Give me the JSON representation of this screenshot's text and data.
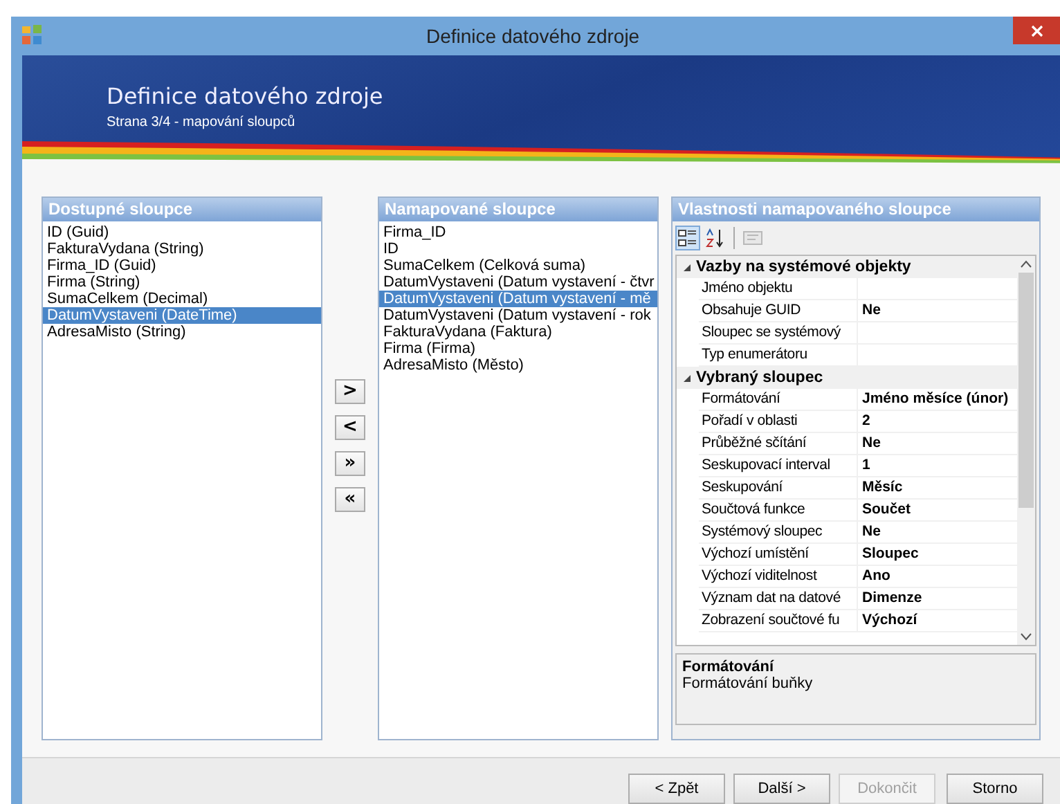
{
  "window": {
    "title": "Definice datového zdroje"
  },
  "banner": {
    "title": "Definice datového zdroje",
    "subtitle": "Strana 3/4 - mapování sloupců"
  },
  "available": {
    "title": "Dostupné sloupce",
    "items": [
      {
        "label": "ID (Guid)",
        "selected": false
      },
      {
        "label": "FakturaVydana (String)",
        "selected": false
      },
      {
        "label": "Firma_ID (Guid)",
        "selected": false
      },
      {
        "label": "Firma (String)",
        "selected": false
      },
      {
        "label": "SumaCelkem (Decimal)",
        "selected": false
      },
      {
        "label": "DatumVystaveni (DateTime)",
        "selected": true
      },
      {
        "label": "AdresaMisto (String)",
        "selected": false
      }
    ]
  },
  "transfer_buttons": [
    {
      "label": ">"
    },
    {
      "label": "<"
    },
    {
      "label": "»"
    },
    {
      "label": "«"
    }
  ],
  "mapped": {
    "title": "Namapované sloupce",
    "items": [
      {
        "label": "Firma_ID",
        "selected": false
      },
      {
        "label": "ID",
        "selected": false
      },
      {
        "label": "SumaCelkem (Celková suma)",
        "selected": false
      },
      {
        "label": "DatumVystaveni (Datum vystavení - čtvr",
        "selected": false
      },
      {
        "label": "DatumVystaveni (Datum vystavení - mě",
        "selected": true
      },
      {
        "label": "DatumVystaveni (Datum vystavení - rok",
        "selected": false
      },
      {
        "label": "FakturaVydana (Faktura)",
        "selected": false
      },
      {
        "label": "Firma (Firma)",
        "selected": false
      },
      {
        "label": "AdresaMisto (Město)",
        "selected": false
      }
    ]
  },
  "properties": {
    "title": "Vlastnosti namapovaného sloupce",
    "toolbar": [
      {
        "kind": "categorized",
        "selected": true,
        "disabled": false
      },
      {
        "kind": "alphabetical",
        "selected": false,
        "disabled": false
      },
      {
        "kind": "pages",
        "selected": false,
        "disabled": true
      }
    ],
    "categories": [
      {
        "name": "Vazby na systémové objekty",
        "expanded": true,
        "rows": [
          {
            "name": "Jméno objektu"
          },
          {
            "name": "Obsahuje GUID",
            "value": "Ne"
          },
          {
            "name": "Sloupec se systémový"
          },
          {
            "name": "Typ enumerátoru"
          }
        ]
      },
      {
        "name": "Vybraný sloupec",
        "expanded": true,
        "rows": [
          {
            "name": "Formátování",
            "value": "Jméno měsíce (únor)"
          },
          {
            "name": "Pořadí v oblasti",
            "value": "2"
          },
          {
            "name": "Průběžné sčítání",
            "value": "Ne"
          },
          {
            "name": "Seskupovací interval",
            "value": "1"
          },
          {
            "name": "Seskupování",
            "value": "Měsíc"
          },
          {
            "name": "Součtová funkce",
            "value": "Součet"
          },
          {
            "name": "Systémový sloupec",
            "value": "Ne"
          },
          {
            "name": "Výchozí umístění",
            "value": "Sloupec"
          },
          {
            "name": "Výchozí viditelnost",
            "value": "Ano"
          },
          {
            "name": "Význam dat na datové",
            "value": "Dimenze"
          },
          {
            "name": "Zobrazení součtové fu",
            "value": "Výchozí"
          }
        ]
      }
    ],
    "description": {
      "title": "Formátování",
      "text": "Formátování buňky"
    }
  },
  "buttons": [
    {
      "label": "< Zpět",
      "disabled": false
    },
    {
      "label": "Další >",
      "disabled": false
    },
    {
      "label": "Dokončit",
      "disabled": true
    },
    {
      "label": "Storno",
      "disabled": false
    }
  ]
}
